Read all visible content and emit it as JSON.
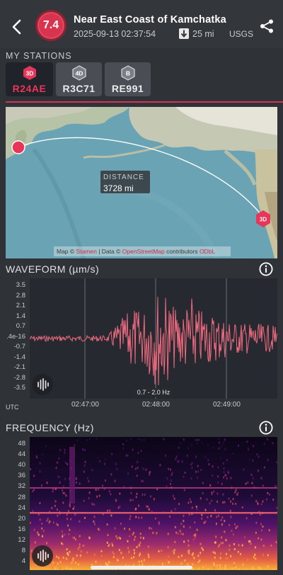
{
  "event": {
    "magnitude": "7.4",
    "title": "Near East Coast of Kamchatka",
    "datetime": "2025-09-13 02:37:54",
    "depth": "25 mi",
    "source": "USGS"
  },
  "stations": {
    "label": "MY STATIONS",
    "items": [
      {
        "badge": "3D",
        "code": "R24AE",
        "selected": true
      },
      {
        "badge": "4D",
        "code": "R3C71",
        "selected": false
      },
      {
        "badge": "B",
        "code": "RE991",
        "selected": false
      }
    ]
  },
  "map": {
    "distance_label": "DISTANCE",
    "distance_value": "3728 mi",
    "station_badge": "3D",
    "attribution_prefix": "Map ©",
    "attribution_provider": "Stamen",
    "attribution_mid": "| Data ©",
    "attribution_data": "OpenStreetMap",
    "attribution_suffix": "contributors",
    "attribution_extra": "ODbL"
  },
  "waveform": {
    "title": "WAVEFORM (µm/s)",
    "y_ticks": [
      "3.5",
      "2.8",
      "2.1",
      "1.4",
      "0.7",
      ".4e-16",
      "-0.7",
      "-1.4",
      "-2.1",
      "-2.8",
      "-3.5"
    ],
    "x_ticks": [
      "02:47:00",
      "02:48:00",
      "02:49:00"
    ],
    "utc_label": "UTC",
    "filter_label": "0.7 - 2.0 Hz"
  },
  "frequency": {
    "title": "FREQUENCY (Hz)",
    "y_ticks": [
      "48",
      "44",
      "40",
      "36",
      "32",
      "28",
      "24",
      "20",
      "16",
      "12",
      "8",
      "4"
    ]
  },
  "colors": {
    "accent": "#e8365a",
    "magnitude_bg": "#d8334f",
    "waveform": "#f06a80",
    "panel_bg": "#2f3338"
  },
  "icons": [
    "back-chevron-icon",
    "depth-arrow-icon",
    "share-icon",
    "info-icon",
    "sound-wave-icon"
  ]
}
